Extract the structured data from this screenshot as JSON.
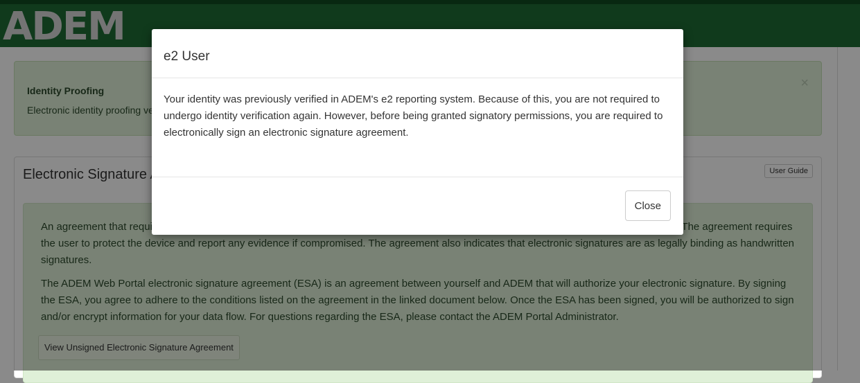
{
  "header": {
    "logo_text": "ADEM"
  },
  "alert": {
    "title": "Identity Proofing",
    "text": "Electronic identity proofing verifies your identity by answering a series of questions about yourself, this must be done in order to have signatory authority.",
    "close_glyph": "×",
    "background_color": "#dff0d8"
  },
  "panel": {
    "title": "Electronic Signature Agreement",
    "user_guide_label": "User Guide",
    "paragraph1": "An agreement that requires a user to be identity proofed and maintain the secrecy of device/password used to create electronic signatures. The agreement requires the user to protect the device and report any evidence if compromised. The agreement also indicates that electronic signatures are as legally binding as handwritten signatures.",
    "paragraph2": "The ADEM Web Portal electronic signature agreement (ESA) is an agreement between yourself and ADEM that will authorize your electronic signature. By signing the ESA, you agree to adhere to the conditions listed on the agreement in the linked document below. Once the ESA has been signed, you will be authorized to sign and/or encrypt information for your data flow. For questions regarding the ESA, please contact the ADEM Portal Administrator.",
    "view_button_label": "View Unsigned Electronic Signature Agreement"
  },
  "modal": {
    "title": "e2 User",
    "body": "Your identity was previously verified in ADEM's e2 reporting system. Because of this, you are not required to undergo identity verification again. However, before being granted signatory permissions, you are required to electronically sign an electronic signature agreement.",
    "close_label": "Close"
  },
  "colors": {
    "header_green": "#1e6b34",
    "overlay": "rgba(0,0,0,0.46)"
  }
}
